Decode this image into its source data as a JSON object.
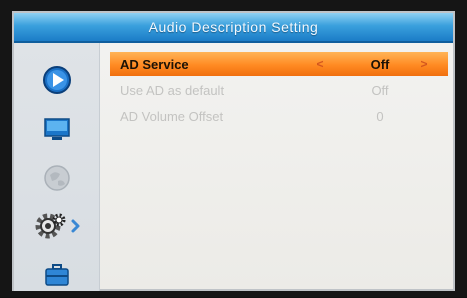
{
  "title": "Audio Description Setting",
  "sidebar": {
    "icons": [
      "play-icon",
      "monitor-icon",
      "globe-icon",
      "settings-gear-icon",
      "toolbox-icon"
    ]
  },
  "settings": [
    {
      "label": "AD Service",
      "value": "Off",
      "selected": true,
      "left_arrow": "<",
      "right_arrow": ">"
    },
    {
      "label": "Use AD as default",
      "value": "Off",
      "selected": false
    },
    {
      "label": "AD Volume Offset",
      "value": "0",
      "selected": false
    }
  ],
  "colors": {
    "title_bar": "#2f90d4",
    "selected_row": "#ff8a22",
    "panel_bg": "#f1f1ef",
    "disabled_text": "#c3c3c1"
  }
}
